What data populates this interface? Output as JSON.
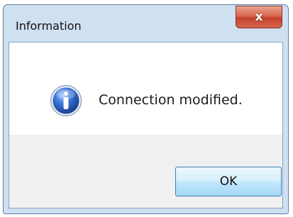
{
  "window": {
    "title": "Information",
    "close_glyph": "x"
  },
  "dialog": {
    "icon": "info-icon",
    "message": "Connection modified.",
    "ok_label": "OK"
  },
  "colors": {
    "icon_blue": "#2a62c9",
    "close_red": "#c2402a",
    "footer_gray": "#f0f0f0"
  }
}
